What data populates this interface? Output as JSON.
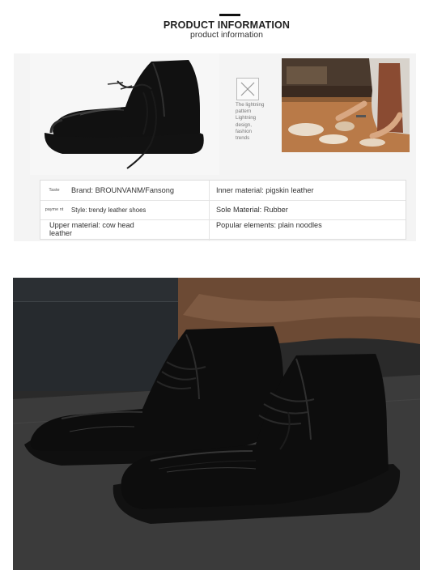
{
  "header": {
    "title": "PRODUCT INFORMATION",
    "subtitle": "product information"
  },
  "craft": {
    "icon": "x-placeholder-icon",
    "caption": [
      "The lightning",
      "pattern",
      "Lightning",
      "design,",
      "fashion",
      "trends"
    ]
  },
  "specs": {
    "rows": [
      {
        "left": {
          "mini": "Taste",
          "text": "Brand: BROUNVANM/Fansong"
        },
        "right": {
          "text": "Inner material: pigskin leather"
        }
      },
      {
        "left": {
          "mini": "payme nt",
          "text": "Style: trendy leather shoes"
        },
        "right": {
          "text": "Sole Material: Rubber"
        }
      },
      {
        "left": {
          "mini": "",
          "text": "Upper material: cow head leather"
        },
        "right": {
          "text": "Popular elements: plain noodles"
        }
      }
    ]
  },
  "colors": {
    "leather": "#0d0d0d",
    "sole": "#111111",
    "wood": "#b97a48",
    "box": "#2b2f33",
    "cloth": "#6c4a34",
    "floor": "#3b3b3b"
  }
}
